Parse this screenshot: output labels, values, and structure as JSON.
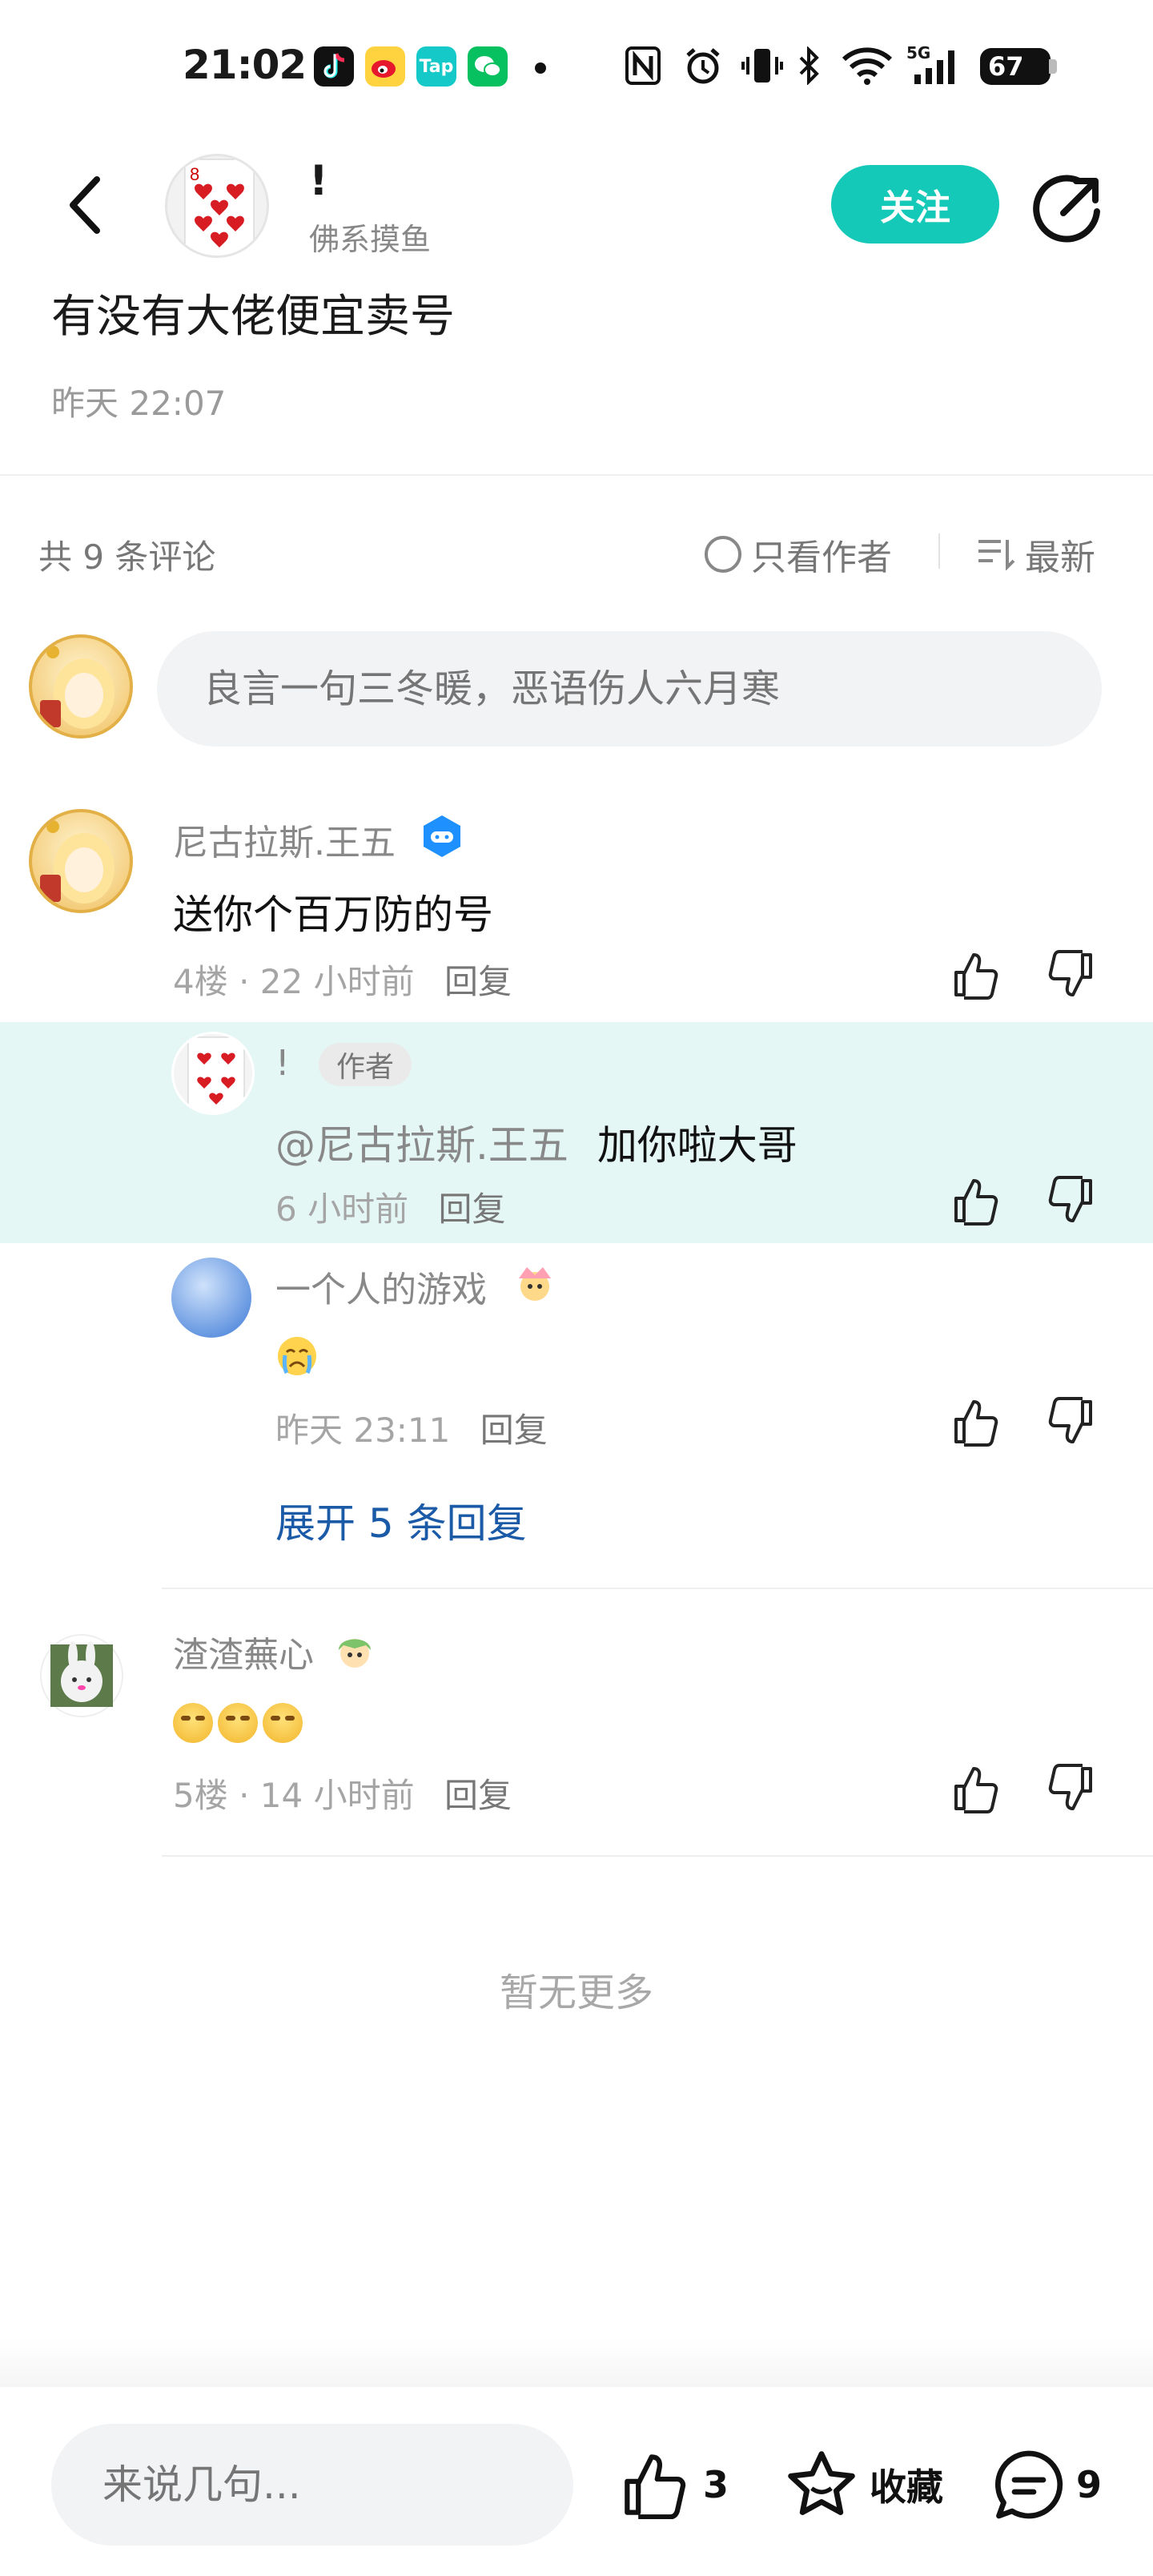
{
  "status_bar": {
    "time": "21:02",
    "notification_icons": [
      "tiktok-icon",
      "weibo-icon",
      "taptap-icon",
      "wechat-icon",
      "dot-icon"
    ],
    "tap_label": "Tap",
    "system_icons": [
      "nfc-icon",
      "alarm-icon",
      "vibrate-icon",
      "bluetooth-icon",
      "wifi-icon",
      "signal-5g-icon"
    ],
    "network_label": "5G",
    "battery": "67"
  },
  "header": {
    "author_name": "!",
    "author_subtitle": "佛系摸鱼",
    "follow_label": "关注",
    "back_icon": "back-chevron-icon",
    "share_icon": "share-icon"
  },
  "post": {
    "title": "有没有大佬便宜卖号",
    "time": "昨天 22:07"
  },
  "comments_header": {
    "count_label": "共 9 条评论",
    "author_only_label": "只看作者",
    "sort_label": "最新"
  },
  "comment_input": {
    "placeholder": "良言一句三冬暖，恶语伤人六月寒"
  },
  "comments": [
    {
      "name": "尼古拉斯.王五",
      "text": "送你个百万防的号",
      "meta": "4楼 · 22 小时前",
      "reply_label": "回复",
      "replies": [
        {
          "name": "!",
          "tag": "作者",
          "mention": "@尼古拉斯.王五",
          "text": "加你啦大哥",
          "meta": "6 小时前",
          "reply_label": "回复"
        },
        {
          "name": "一个人的游戏",
          "meta": "昨天 23:11",
          "reply_label": "回复"
        }
      ],
      "expand_label": "展开 5 条回复"
    },
    {
      "name": "渣渣蕪心",
      "meta": "5楼 · 14 小时前",
      "reply_label": "回复"
    }
  ],
  "footer": {
    "no_more": "暂无更多"
  },
  "bottom_bar": {
    "input_placeholder": "来说几句...",
    "like_count": "3",
    "favorite_label": "收藏",
    "comment_count": "9"
  },
  "colors": {
    "accent": "#15c9b8",
    "highlight_bg": "#e4f7f5",
    "link": "#1a5aa6",
    "muted": "#9a9a9a"
  }
}
